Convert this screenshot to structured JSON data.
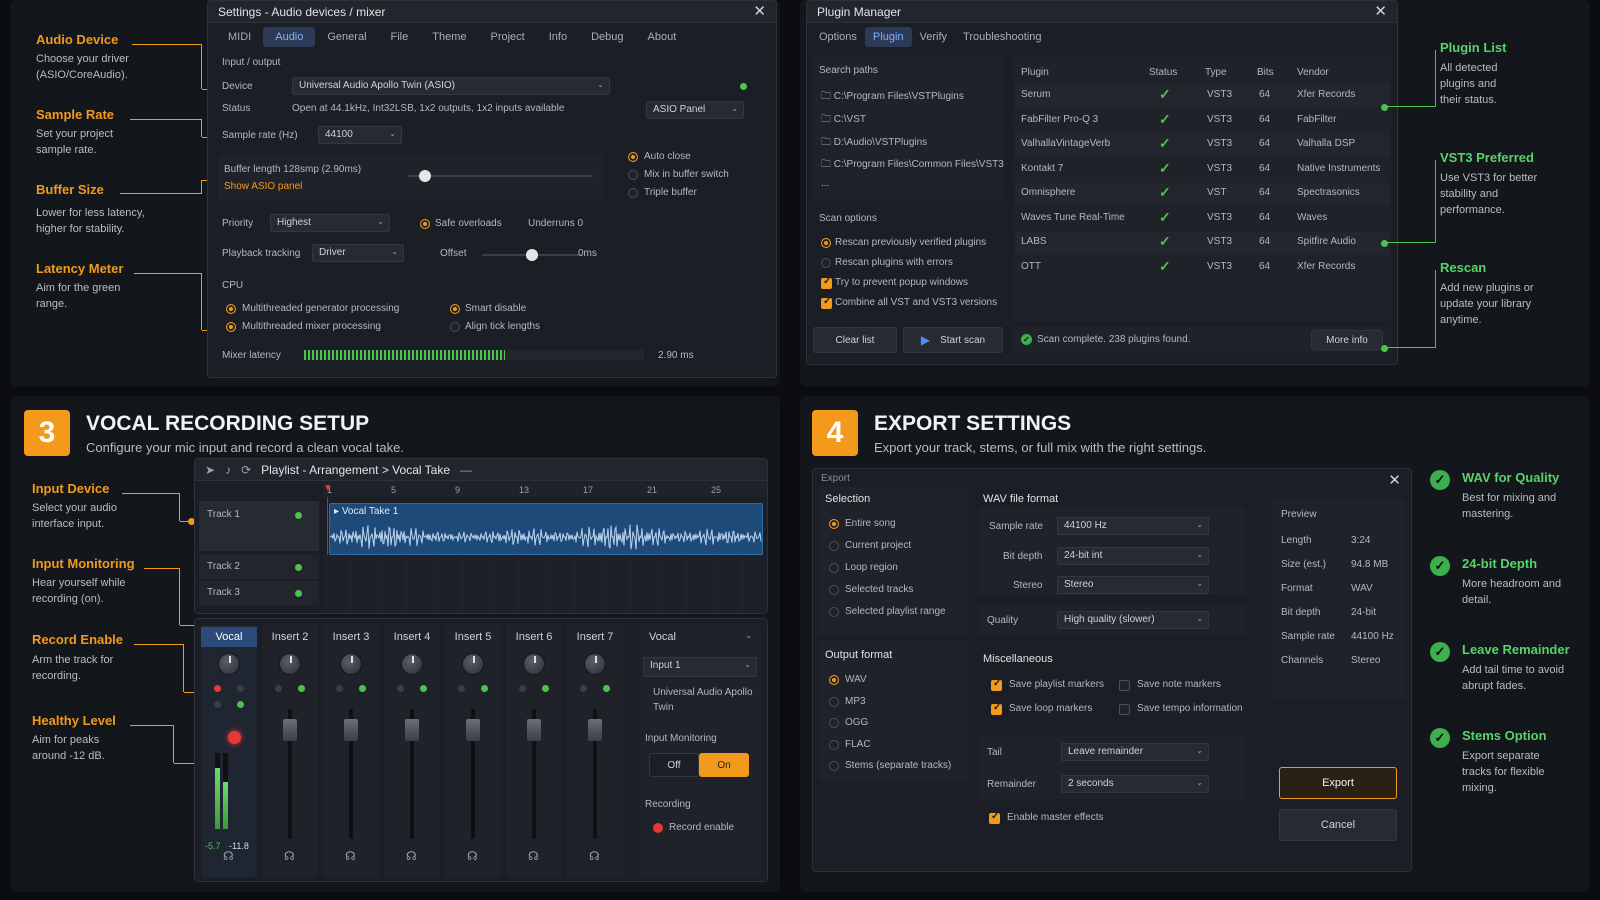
{
  "audio": {
    "title": "Settings - Audio devices / mixer",
    "tabs": [
      "MIDI",
      "Audio",
      "General",
      "File",
      "Theme",
      "Project",
      "Info",
      "Debug",
      "About"
    ],
    "active_tab": "Audio",
    "section_io": "Input / output",
    "device_label": "Device",
    "device_value": "Universal Audio Apollo Twin (ASIO)",
    "status_label": "Status",
    "status_value": "Open at 44.1kHz, Int32LSB, 1x2 outputs, 1x2 inputs available",
    "asio_panel": "ASIO Panel",
    "sample_rate_label": "Sample rate (Hz)",
    "sample_rate_value": "44100",
    "buffer_label": "Buffer length 128smp (2.90ms)",
    "buffer_fraction": 0.09,
    "show_asio": "Show ASIO panel",
    "auto_close": "Auto close",
    "mix_buffer": "Mix in buffer switch",
    "triple_buffer": "Triple buffer",
    "priority_label": "Priority",
    "priority_value": "Highest",
    "safe_overloads": "Safe overloads",
    "underruns": "Underruns  0",
    "playback_label": "Playback tracking",
    "playback_value": "Driver",
    "offset_label": "Offset",
    "offset_value": "0ms",
    "offset_fraction": 0.5,
    "cpu": "CPU",
    "mt_gen": "Multithreaded generator processing",
    "mt_mix": "Multithreaded mixer processing",
    "smart_disable": "Smart disable",
    "align_tick": "Align tick lengths",
    "latency_label": "Mixer latency",
    "latency_value": "2.90 ms",
    "latency_fraction": 0.59
  },
  "left_callouts": [
    {
      "title": "Audio Device",
      "desc": "Choose your driver (ASIO/CoreAudio)."
    },
    {
      "title": "Sample Rate",
      "desc": "Set your project sample rate."
    },
    {
      "title": "Buffer Size",
      "desc": "Lower for less latency, higher for stability."
    },
    {
      "title": "Latency Meter",
      "desc": "Aim for the green range."
    }
  ],
  "plugin": {
    "title": "Plugin Manager",
    "tabs": [
      "Options",
      "Plugin",
      "Verify",
      "Troubleshooting"
    ],
    "active_tab": "Plugin",
    "search_paths_label": "Search paths",
    "paths": [
      "C:\\Program Files\\VSTPlugins",
      "C:\\VST",
      "D:\\Audio\\VSTPlugins",
      "C:\\Program Files\\Common Files\\VST3",
      "..."
    ],
    "scan_options_label": "Scan options",
    "opt1": "Rescan previously verified plugins",
    "opt2": "Rescan plugins with errors",
    "opt3": "Try to prevent popup windows",
    "opt4": "Combine all VST and VST3 versions",
    "clear_list": "Clear list",
    "start_scan": "Start scan",
    "columns": [
      "Plugin",
      "Status",
      "Type",
      "Bits",
      "Vendor"
    ],
    "rows": [
      {
        "name": "Serum",
        "type": "VST3",
        "bits": "64",
        "vendor": "Xfer Records"
      },
      {
        "name": "FabFilter Pro-Q 3",
        "type": "VST3",
        "bits": "64",
        "vendor": "FabFilter"
      },
      {
        "name": "ValhallaVintageVerb",
        "type": "VST3",
        "bits": "64",
        "vendor": "Valhalla DSP"
      },
      {
        "name": "Kontakt 7",
        "type": "VST3",
        "bits": "64",
        "vendor": "Native Instruments"
      },
      {
        "name": "Omnisphere",
        "type": "VST",
        "bits": "64",
        "vendor": "Spectrasonics"
      },
      {
        "name": "Waves Tune Real-Time",
        "type": "VST3",
        "bits": "64",
        "vendor": "Waves"
      },
      {
        "name": "LABS",
        "type": "VST3",
        "bits": "64",
        "vendor": "Spitfire Audio"
      },
      {
        "name": "OTT",
        "type": "VST3",
        "bits": "64",
        "vendor": "Xfer Records"
      }
    ],
    "scan_status": "Scan complete. 238 plugins found.",
    "more_info": "More info"
  },
  "right_callouts": [
    {
      "title": "Plugin List",
      "desc": "All detected plugins and their status."
    },
    {
      "title": "VST3 Preferred",
      "desc": "Use VST3 for better stability and performance."
    },
    {
      "title": "Rescan",
      "desc": "Add new plugins or update your library anytime."
    }
  ],
  "vocal": {
    "step": "3",
    "title": "VOCAL RECORDING SETUP",
    "subtitle": "Configure your mic input and record a clean vocal take.",
    "playlist_title": "Playlist - Arrangement  >  Vocal Take",
    "ruler": [
      "1",
      "5",
      "9",
      "13",
      "17",
      "21",
      "25",
      "1"
    ],
    "tracks": [
      "Track 1",
      "Track 2",
      "Track 3"
    ],
    "clip_name": "Vocal Take 1",
    "channels": [
      "Vocal",
      "Insert 2",
      "Insert 3",
      "Insert 4",
      "Insert 5",
      "Insert 6",
      "Insert 7"
    ],
    "meter_l": "-5.7",
    "meter_r": "-11.8",
    "input_name": "Vocal",
    "input_select": "Input 1",
    "interface": "Universal Audio Apollo Twin",
    "monitoring_label": "Input Monitoring",
    "off": "Off",
    "on": "On",
    "recording_label": "Recording",
    "record_enable": "Record enable"
  },
  "vocal_callouts": [
    {
      "title": "Input Device",
      "desc": "Select your audio interface input."
    },
    {
      "title": "Input Monitoring",
      "desc": "Hear yourself while recording (on)."
    },
    {
      "title": "Record Enable",
      "desc": "Arm the track for recording."
    },
    {
      "title": "Healthy Level",
      "desc": "Aim for peaks around -12 dB."
    }
  ],
  "export": {
    "step": "4",
    "title": "EXPORT SETTINGS",
    "subtitle": "Export your track, stems, or full mix with the right settings.",
    "window_title": "Export",
    "selection_label": "Selection",
    "selection": [
      "Entire song",
      "Current project",
      "Loop region",
      "Selected tracks",
      "Selected playlist range"
    ],
    "output_label": "Output format",
    "formats": [
      "WAV",
      "MP3",
      "OGG",
      "FLAC",
      "Stems (separate tracks)"
    ],
    "wav_label": "WAV file format",
    "sample_rate_label": "Sample rate",
    "sample_rate_value": "44100 Hz",
    "bit_depth_label": "Bit depth",
    "bit_depth_value": "24-bit int",
    "stereo_label": "Stereo",
    "stereo_value": "Stereo",
    "quality_label": "Quality",
    "quality_value": "High quality (slower)",
    "misc_label": "Miscellaneous",
    "save_playlist": "Save playlist markers",
    "save_note": "Save note markers",
    "save_loop": "Save loop markers",
    "save_tempo": "Save tempo information",
    "tail_label": "Tail",
    "tail_value": "Leave remainder",
    "remainder_label": "Remainder",
    "remainder_value": "2 seconds",
    "master_fx": "Enable master effects",
    "preview_label": "Preview",
    "preview": [
      {
        "k": "Length",
        "v": "3:24"
      },
      {
        "k": "Size (est.)",
        "v": "94.8 MB"
      },
      {
        "k": "Format",
        "v": "WAV"
      },
      {
        "k": "Bit depth",
        "v": "24-bit"
      },
      {
        "k": "Sample rate",
        "v": "44100 Hz"
      },
      {
        "k": "Channels",
        "v": "Stereo"
      }
    ],
    "export_btn": "Export",
    "cancel_btn": "Cancel"
  },
  "export_callouts": [
    {
      "title": "WAV for Quality",
      "desc": "Best for mixing and mastering."
    },
    {
      "title": "24-bit Depth",
      "desc": "More headroom and detail."
    },
    {
      "title": "Leave Remainder",
      "desc": "Add tail time to avoid abrupt fades."
    },
    {
      "title": "Stems Option",
      "desc": "Export separate tracks for flexible mixing."
    }
  ],
  "colors": {
    "accent": "#f39a1c",
    "green": "#4ec24e",
    "selected_tab": "#2c3a55"
  }
}
